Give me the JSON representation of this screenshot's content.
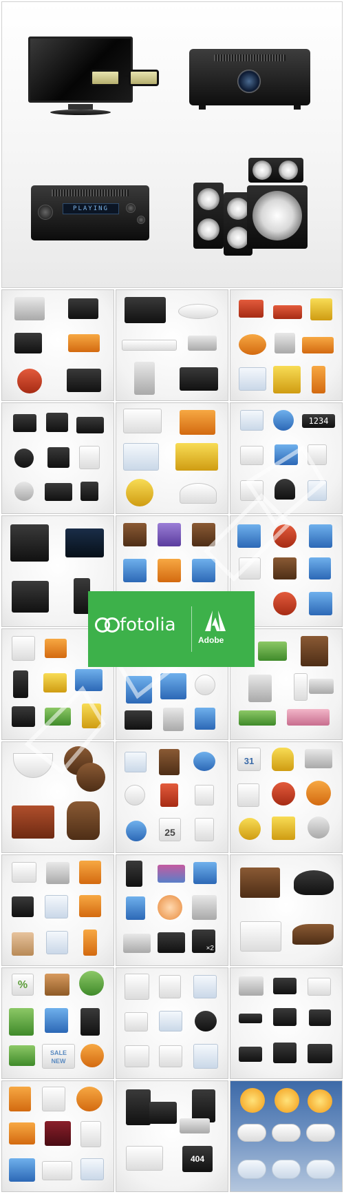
{
  "hero": {
    "receiver_display": "PLAYING"
  },
  "banner": {
    "brand": "fotolia",
    "partner": "Adobe"
  },
  "icons": {
    "calendar_day": "25",
    "counter": "1234",
    "percent": "%",
    "sale_tag": "SALE",
    "new_tag": "NEW",
    "error_sign": "404",
    "multiplier": "×2",
    "calendar_top": "31"
  },
  "colors": {
    "banner_green": "#3db14a",
    "weather_sky": "#3d6aa8"
  }
}
